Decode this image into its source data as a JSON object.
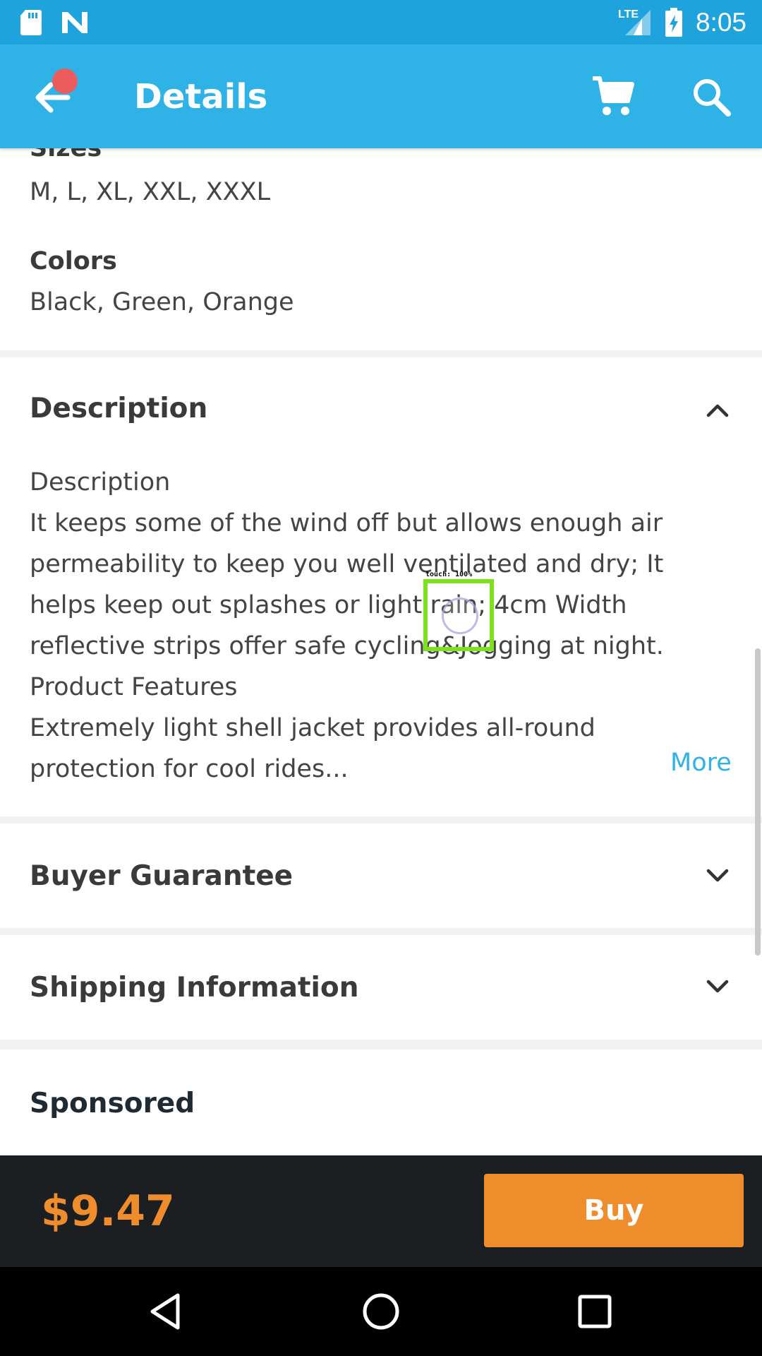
{
  "status_bar": {
    "time": "8:05",
    "network": "LTE",
    "icons": [
      "sd-card-icon",
      "n-notification-icon",
      "lte-signal-icon",
      "battery-charging-icon"
    ],
    "color": "#1ea3dc"
  },
  "app_bar": {
    "title": "Details",
    "back_icon": "arrow-left-icon",
    "cart_icon": "cart-icon",
    "search_icon": "search-icon",
    "color": "#2fb2e6",
    "notification_dot_color": "#ec5c5c"
  },
  "product": {
    "sizes_label": "Sizes",
    "sizes_value": "M, L, XL, XXL, XXXL",
    "colors_label": "Colors",
    "colors_value": "Black, Green, Orange"
  },
  "description": {
    "title": "Description",
    "lines": [
      "Description",
      "It keeps some of the wind off but allows enough air",
      "permeability to keep you well ventilated and dry; It",
      "helps keep out splashes or light rain; 4cm Width",
      "reflective strips offer safe cycling&Jogging at night.",
      "Product Features",
      "Extremely light shell jacket provides all-round",
      "protection for cool rides..."
    ],
    "more_label": "More",
    "toggle_icon": "chevron-up-icon"
  },
  "sections": {
    "buyer_guarantee": "Buyer Guarantee",
    "shipping_information": "Shipping Information",
    "sponsored": "Sponsored"
  },
  "touch_indicator": {
    "label": "touch: 100%"
  },
  "purchase": {
    "price": "$9.47",
    "buy_label": "Buy",
    "accent": "#ef8d2d"
  },
  "nav_bar": {
    "icons": [
      "back-triangle-icon",
      "home-circle-icon",
      "recents-square-icon"
    ]
  }
}
